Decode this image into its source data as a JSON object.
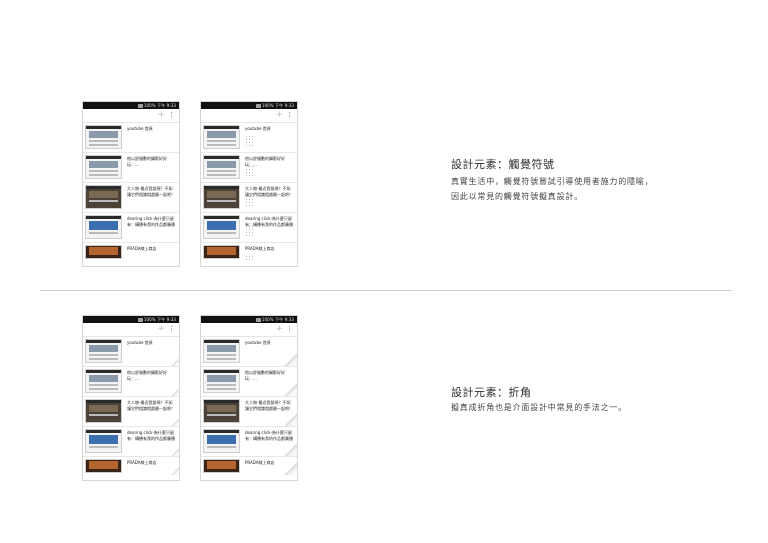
{
  "phone": {
    "status_text": "100% 下午 9:33",
    "items": [
      {
        "title": "youtube 首頁"
      },
      {
        "title": "他以舒服數的攝影好好玩：..."
      },
      {
        "title": "大人物-最近我發現？不如讓它們相識相處最一起吧！"
      },
      {
        "title": "dearing click-為什麼只留有：構播有潔的作品都廣播"
      },
      {
        "title": "PRADA線上商店"
      }
    ]
  },
  "section1": {
    "heading": "設計元素：觸覺符號",
    "desc_lines": [
      "真實生活中，觸覺符號嘗試引導使用者施力的隱喻，",
      "因此以常見的觸覺符號擬真設計。"
    ]
  },
  "section2": {
    "heading": "設計元素：折角",
    "desc_lines": [
      "擬真成折角也是介面設計中常見的手法之一。"
    ]
  }
}
